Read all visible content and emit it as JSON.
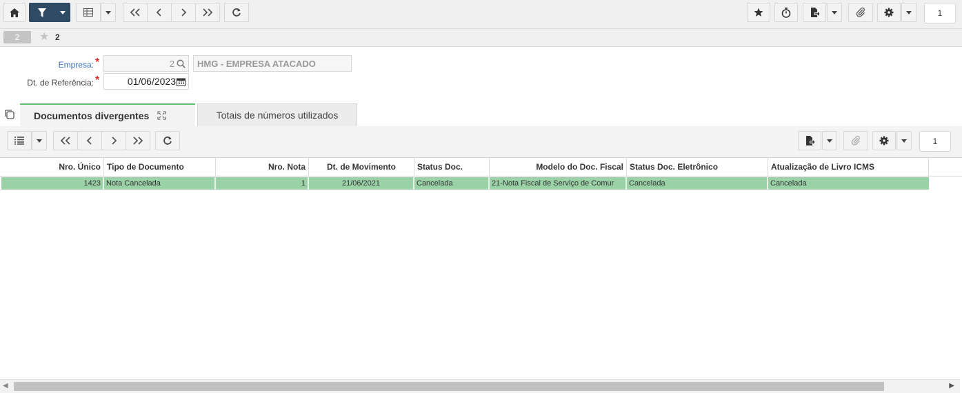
{
  "toolbar": {
    "page_number": "1",
    "icons": [
      "home-icon",
      "filter-icon",
      "table-icon",
      "first-page-icon",
      "previous-page-icon",
      "next-page-icon",
      "last-page-icon",
      "refresh-icon",
      "star-icon",
      "timer-icon",
      "export-icon",
      "attachment-icon",
      "gear-icon"
    ]
  },
  "subbar": {
    "record_badge": "2",
    "favorites_count": "2"
  },
  "filters": {
    "empresa": {
      "label": "Empresa:",
      "code": "2",
      "name": "HMG - EMPRESA ATACADO"
    },
    "dt_referencia": {
      "label": "Dt. de Referência:",
      "value": "01/06/2023"
    }
  },
  "tabs": [
    {
      "label": "Documentos divergentes",
      "active": true
    },
    {
      "label": "Totais de números utilizados",
      "active": false
    }
  ],
  "grid_toolbar": {
    "page_number": "1"
  },
  "grid": {
    "columns": [
      "Nro. Único",
      "Tipo de Documento",
      "Nro. Nota",
      "Dt. de Movimento",
      "Status Doc.",
      "Modelo do Doc. Fiscal",
      "Status Doc. Eletrônico",
      "Atualização de Livro ICMS"
    ],
    "rows": [
      [
        "1423",
        "Nota Cancelada",
        "1",
        "21/06/2021",
        "Cancelada",
        "21-Nota Fiscal de Serviço de Comur",
        "Cancelada",
        "Cancelada"
      ]
    ]
  },
  "colors": {
    "primary_dark": "#2f4a63",
    "selected_row": "#9ad1a6",
    "required": "#e0322f",
    "active_tab_accent": "#60bf6f",
    "label_blue": "#3a6fc4"
  }
}
